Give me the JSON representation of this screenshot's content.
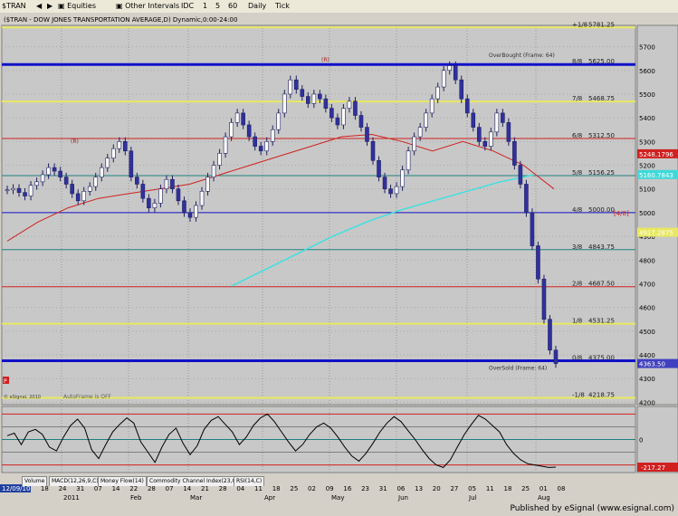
{
  "toolbar": {
    "symbol": "$TRAN",
    "equities_label": "Equities",
    "other_intervals_label": "Other Intervals",
    "interval_buttons": [
      "IDC",
      "1",
      "5",
      "60",
      "Daily",
      "Tick"
    ]
  },
  "chart_title": "($TRAN - DOW JONES TRANSPORTATION AVERAGE,D) Dynamic,0:00-24:00",
  "date_box": "12/09/10",
  "murrey_lines": [
    {
      "label": "+1/8",
      "value": 5781.25,
      "text": "5781.25",
      "color": "#e8e860",
      "width": 2
    },
    {
      "label": "8/8",
      "value": 5625.0,
      "text": "5625.00",
      "color": "#1010c8",
      "width": 3
    },
    {
      "label": "7/8",
      "value": 5468.75,
      "text": "5468.75",
      "color": "#e8e860",
      "width": 2
    },
    {
      "label": "6/8",
      "value": 5312.5,
      "text": "5312.50",
      "color": "#d02020",
      "width": 1
    },
    {
      "label": "5/8",
      "value": 5156.25,
      "text": "5156.25",
      "color": "#208080",
      "width": 1
    },
    {
      "label": "4/8",
      "value": 5000.0,
      "text": "5000.00",
      "color": "#1010c8",
      "width": 1
    },
    {
      "label": "3/8",
      "value": 4843.75,
      "text": "4843.75",
      "color": "#208080",
      "width": 1
    },
    {
      "label": "2/8",
      "value": 4687.5,
      "text": "4687.50",
      "color": "#d02020",
      "width": 1
    },
    {
      "label": "1/8",
      "value": 4531.25,
      "text": "4531.25",
      "color": "#e8e860",
      "width": 2
    },
    {
      "label": "0/8",
      "value": 4375.0,
      "text": "4375.00",
      "color": "#1010c8",
      "width": 3
    },
    {
      "label": "-1/8",
      "value": 4218.75,
      "text": "4218.75",
      "color": "#e8e860",
      "width": 2
    }
  ],
  "annotations": {
    "overbought": "OverBought (Frame: 64)",
    "oversold": "OverSold (Frame: 64)",
    "four_eight_tag": "[4/8]",
    "autoframe": "AutoFrame is OFF",
    "copyright": "© eSignal, 2010",
    "r_marker": "(R)",
    "p_marker": "P"
  },
  "price_tags": [
    {
      "text": "5248.1796",
      "value": 5248.18,
      "color": "#d02020"
    },
    {
      "text": "5160.7843",
      "value": 5160.78,
      "color": "#40d8d8"
    },
    {
      "text": "4917.2875",
      "value": 4917.29,
      "color": "#e8e860"
    },
    {
      "text": "4363.50",
      "value": 4363.5,
      "color": "#4040c0"
    }
  ],
  "cci_last": "-217.27",
  "tabs": [
    "Volume",
    "MACD(12,26,9,C)",
    "Money Flow(14)",
    "Commodity Channel Index(23,C)",
    "RSI(14,C)"
  ],
  "footer": "Published by eSignal (www.esignal.com)",
  "chart_data": {
    "type": "candlestick",
    "title": "($TRAN - DOW JONES TRANSPORTATION AVERAGE,D) Dynamic,0:00-24:00",
    "x_month_labels": [
      "2011",
      "Feb",
      "Mar",
      "Apr",
      "May",
      "Jun",
      "Jul",
      "Aug"
    ],
    "x_day_labels": [
      "03",
      "10",
      "18",
      "24",
      "31",
      "07",
      "14",
      "22",
      "28",
      "07",
      "14",
      "21",
      "28",
      "04",
      "11",
      "18",
      "25",
      "02",
      "09",
      "16",
      "23",
      "31",
      "06",
      "13",
      "20",
      "27",
      "05",
      "11",
      "18",
      "25",
      "01",
      "08"
    ],
    "y_ticks": [
      4200,
      4300,
      4400,
      4500,
      4600,
      4700,
      4800,
      4900,
      5000,
      5100,
      5200,
      5300,
      5400,
      5500,
      5600,
      5700
    ],
    "ylim": [
      4190,
      5790
    ],
    "close": [
      5096,
      5102,
      5085,
      5070,
      5115,
      5130,
      5160,
      5190,
      5175,
      5150,
      5120,
      5080,
      5050,
      5090,
      5110,
      5150,
      5190,
      5230,
      5270,
      5300,
      5260,
      5150,
      5120,
      5060,
      5020,
      5040,
      5100,
      5140,
      5100,
      5050,
      5000,
      4980,
      5030,
      5090,
      5150,
      5200,
      5250,
      5320,
      5380,
      5420,
      5370,
      5320,
      5280,
      5260,
      5300,
      5350,
      5420,
      5500,
      5560,
      5520,
      5490,
      5460,
      5500,
      5480,
      5440,
      5400,
      5370,
      5440,
      5470,
      5410,
      5360,
      5300,
      5220,
      5150,
      5100,
      5080,
      5110,
      5180,
      5260,
      5320,
      5360,
      5420,
      5480,
      5530,
      5600,
      5620,
      5560,
      5480,
      5420,
      5360,
      5300,
      5280,
      5340,
      5420,
      5380,
      5300,
      5200,
      5120,
      5000,
      4860,
      4720,
      4550,
      4420,
      4363.5
    ],
    "sma_red": [
      4880,
      4960,
      5020,
      5060,
      5080,
      5100,
      5120,
      5160,
      5200,
      5240,
      5280,
      5320,
      5330,
      5300,
      5260,
      5300,
      5260,
      5200,
      5100
    ],
    "sma_cyan": [
      4690,
      4760,
      4830,
      4900,
      4960,
      5010,
      5050,
      5090,
      5130,
      5160
    ],
    "cci": {
      "range": [
        -260,
        260
      ],
      "last": -217.27,
      "levels": [
        200,
        100,
        0,
        -100,
        -200
      ],
      "values": [
        30,
        50,
        -40,
        60,
        80,
        40,
        -60,
        -90,
        20,
        110,
        160,
        90,
        -80,
        -150,
        -40,
        60,
        120,
        170,
        130,
        -20,
        -100,
        -180,
        -60,
        40,
        90,
        -30,
        -120,
        -50,
        80,
        150,
        180,
        120,
        60,
        -40,
        20,
        110,
        170,
        200,
        140,
        60,
        -20,
        -90,
        -40,
        40,
        100,
        130,
        90,
        20,
        -60,
        -130,
        -170,
        -110,
        -30,
        60,
        130,
        180,
        140,
        70,
        0,
        -80,
        -150,
        -200,
        -220,
        -160,
        -60,
        40,
        120,
        190,
        160,
        110,
        60,
        -40,
        -110,
        -160,
        -190,
        -200,
        -210,
        -220,
        -217.27
      ]
    }
  }
}
